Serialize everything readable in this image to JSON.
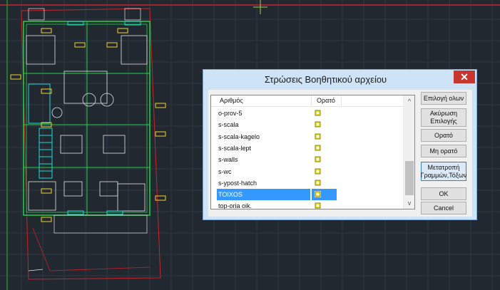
{
  "dialog": {
    "title": "Στρώσεις Βοηθητικού αρχείου",
    "close_glyph": "✕",
    "columns": {
      "name": "Αριθμός",
      "visible": "Ορατό"
    },
    "layers": [
      {
        "name": "o-prov-5",
        "selected": false
      },
      {
        "name": "s-scala",
        "selected": false
      },
      {
        "name": "s-scala-kagelo",
        "selected": false
      },
      {
        "name": "s-scala-lept",
        "selected": false
      },
      {
        "name": "s-walls",
        "selected": false
      },
      {
        "name": "s-wc",
        "selected": false
      },
      {
        "name": "s-ypost-hatch",
        "selected": false
      },
      {
        "name": "TOIXOS",
        "selected": true
      },
      {
        "name": "top-oria oik.",
        "selected": false
      }
    ],
    "scroll_up": "^",
    "scroll_down": "v",
    "buttons": {
      "select_all": "Επιλογή ολων",
      "cancel_selection_1": "Ακύρωση",
      "cancel_selection_2": "Επιλογής",
      "visible": "Ορατό",
      "not_visible": "Μη ορατό",
      "convert_1": "Μετατροπή",
      "convert_2": "Γραμμών,Τόξων",
      "ok": "OK",
      "cancel": "Cancel"
    }
  },
  "icons": {
    "visible": "lightbulb-on-icon",
    "close": "close-icon"
  },
  "colors": {
    "canvas": "#212830",
    "grid": "#2f3742",
    "accent_select": "#3399ff",
    "close_red": "#c7372f",
    "title_bar": "#cfe3f6"
  }
}
